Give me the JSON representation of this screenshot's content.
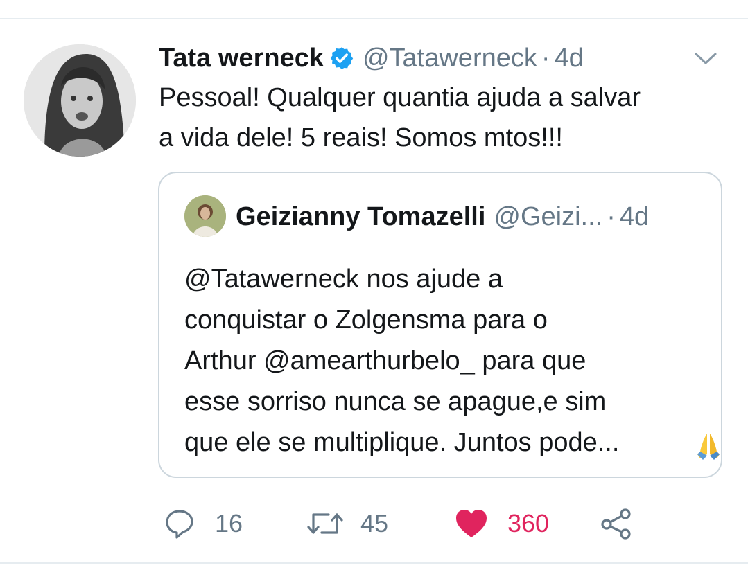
{
  "tweet": {
    "author_name": "Tata werneck",
    "author_handle": "@Tatawerneck",
    "separator": "·",
    "time": "4d",
    "text": "Pessoal! Qualquer quantia ajuda a salvar\na vida dele! 5 reais! Somos mtos!!!",
    "avatar_icon": "profile-photo",
    "verified_icon": "verified-badge-icon",
    "menu_icon": "chevron-down-icon"
  },
  "quoted_tweet": {
    "author_name": "Geizianny Tomazelli",
    "author_handle": "@Geizi...",
    "separator": "·",
    "time": "4d",
    "text": "@Tatawerneck nos ajude a\nconquistar o Zolgensma para o\nArthur @amearthurbelo_ para que\nesse sorriso nunca se apague,e sim\nque ele se multiplique. Juntos pode...",
    "trailing_emoji": "folded-hands-emoji"
  },
  "actions": {
    "reply_count": "16",
    "retweet_count": "45",
    "like_count": "360",
    "reply_icon": "reply-icon",
    "retweet_icon": "retweet-icon",
    "like_icon": "heart-icon",
    "share_icon": "share-icon"
  },
  "colors": {
    "text_primary": "#14171a",
    "text_secondary": "#657786",
    "verified_blue": "#1da1f2",
    "like_red": "#e0245e",
    "border": "#ccd6dd"
  }
}
